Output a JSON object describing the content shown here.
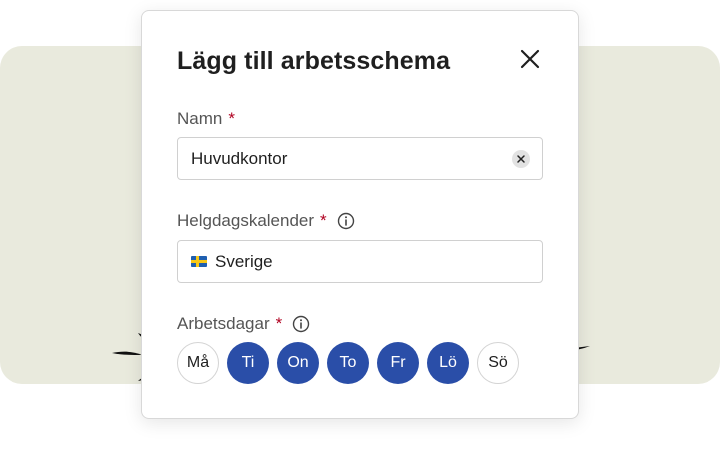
{
  "dialog": {
    "title": "Lägg till arbetsschema",
    "close_icon": "close-icon"
  },
  "fields": {
    "name": {
      "label": "Namn",
      "required_mark": "*",
      "value": "Huvudkontor",
      "clear_icon": "clear-icon"
    },
    "holiday_calendar": {
      "label": "Helgdagskalender",
      "required_mark": "*",
      "info_icon": "info-icon",
      "flag_icon": "flag-sweden-icon",
      "value": "Sverige"
    },
    "workdays": {
      "label": "Arbetsdagar",
      "required_mark": "*",
      "info_icon": "info-icon",
      "days": [
        {
          "label": "Må",
          "selected": false
        },
        {
          "label": "Ti",
          "selected": true
        },
        {
          "label": "On",
          "selected": true
        },
        {
          "label": "To",
          "selected": true
        },
        {
          "label": "Fr",
          "selected": true
        },
        {
          "label": "Lö",
          "selected": true
        },
        {
          "label": "Sö",
          "selected": false
        }
      ]
    }
  },
  "colors": {
    "selected_day": "#2a4ea8",
    "required_mark": "#b00020",
    "backdrop": "#e9eadd"
  }
}
